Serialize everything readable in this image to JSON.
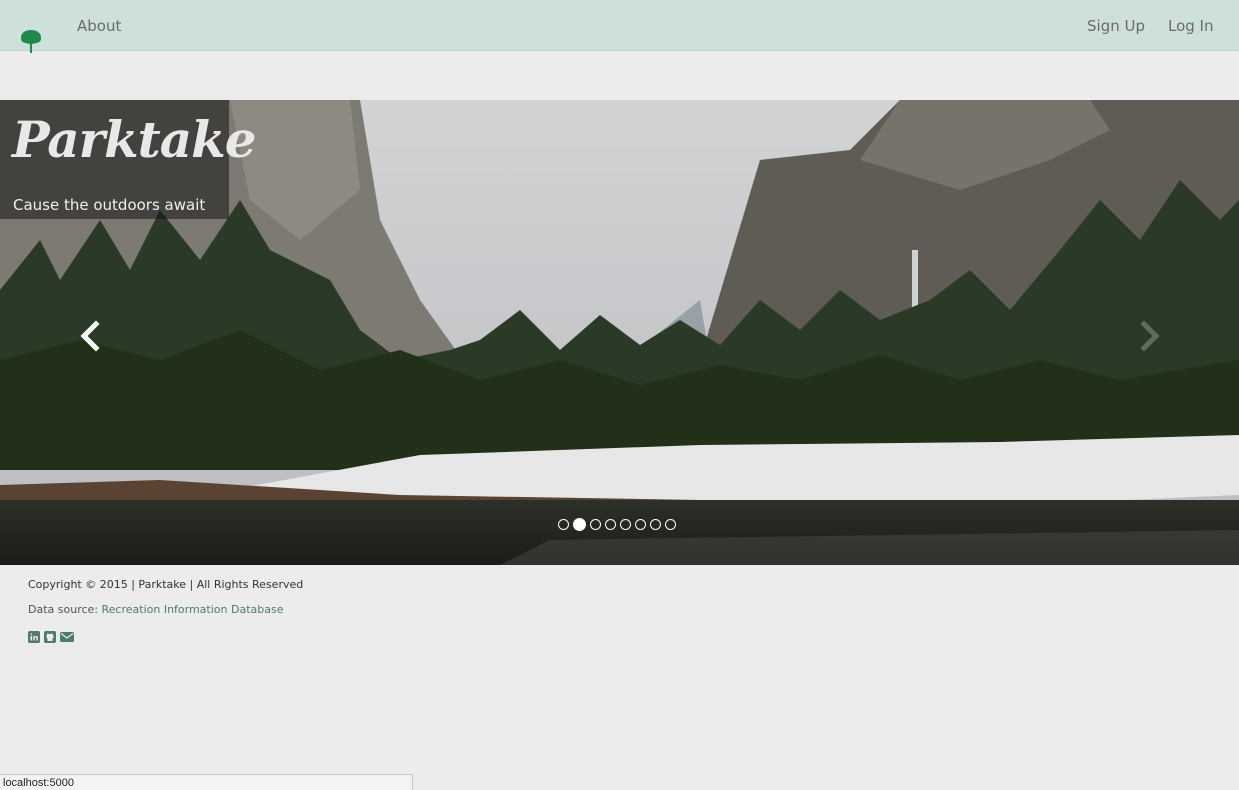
{
  "nav": {
    "about": "About",
    "sign_up": "Sign Up",
    "log_in": "Log In",
    "logo_icon": "tree-icon"
  },
  "hero": {
    "brand": "Parktake",
    "tagline": "Cause the outdoors await",
    "prev_icon": "chevron-left-icon",
    "next_icon": "chevron-right-icon",
    "slide_count": 8,
    "active_slide": 2
  },
  "footer": {
    "copyright": "Copyright © 2015 | Parktake | All Rights Reserved",
    "data_source_prefix": "Data source: ",
    "data_source_link": "Recreation Information Database",
    "social_icons": [
      "linkedin-icon",
      "github-icon",
      "envelope-icon"
    ]
  },
  "status_bar": {
    "url": "localhost:5000"
  },
  "colors": {
    "navbar_bg": "#cde0da",
    "page_bg": "#ececec",
    "logo_green": "#1f8a4c",
    "link_teal": "#4e7a73"
  }
}
